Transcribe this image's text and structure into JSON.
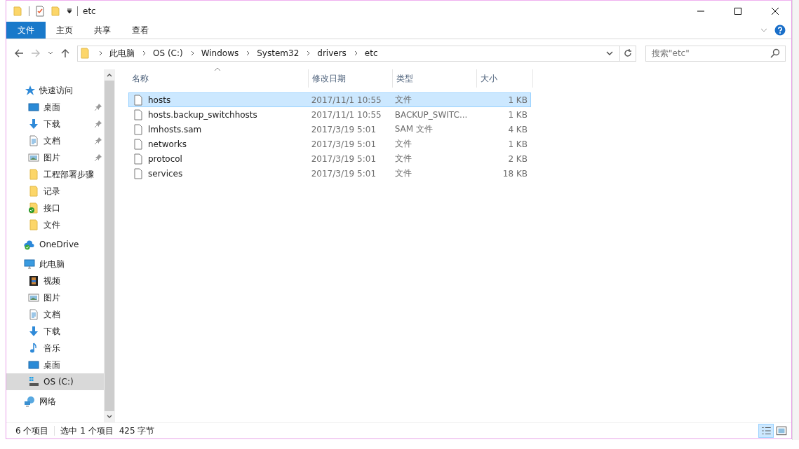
{
  "window": {
    "title": "etc"
  },
  "ribbon": {
    "tabs": [
      {
        "label": "文件",
        "selected": true
      },
      {
        "label": "主页",
        "selected": false
      },
      {
        "label": "共享",
        "selected": false
      },
      {
        "label": "查看",
        "selected": false
      }
    ]
  },
  "address": {
    "breadcrumbs": [
      "此电脑",
      "OS (C:)",
      "Windows",
      "System32",
      "drivers",
      "etc"
    ]
  },
  "search": {
    "placeholder": "搜索\"etc\""
  },
  "sidebar": {
    "sections": [
      {
        "label": "快速访问",
        "kind": "star",
        "selected": false,
        "children": [
          {
            "label": "桌面",
            "kind": "desktop",
            "pinned": true,
            "selected": false
          },
          {
            "label": "下载",
            "kind": "download",
            "pinned": true,
            "selected": false
          },
          {
            "label": "文档",
            "kind": "document",
            "pinned": true,
            "selected": false
          },
          {
            "label": "图片",
            "kind": "picture",
            "pinned": true,
            "selected": false
          },
          {
            "label": "工程部署步骤",
            "kind": "folder",
            "pinned": false,
            "selected": false
          },
          {
            "label": "记录",
            "kind": "folder",
            "pinned": false,
            "selected": false
          },
          {
            "label": "接口",
            "kind": "folder-synced",
            "pinned": false,
            "selected": false
          },
          {
            "label": "文件",
            "kind": "folder",
            "pinned": false,
            "selected": false
          }
        ]
      },
      {
        "label": "OneDrive",
        "kind": "cloud",
        "selected": false
      },
      {
        "label": "此电脑",
        "kind": "computer",
        "selected": false,
        "children": [
          {
            "label": "视频",
            "kind": "video",
            "pinned": false,
            "selected": false
          },
          {
            "label": "图片",
            "kind": "picture",
            "pinned": false,
            "selected": false
          },
          {
            "label": "文档",
            "kind": "document",
            "pinned": false,
            "selected": false
          },
          {
            "label": "下载",
            "kind": "download",
            "pinned": false,
            "selected": false
          },
          {
            "label": "音乐",
            "kind": "music",
            "pinned": false,
            "selected": false
          },
          {
            "label": "桌面",
            "kind": "desktop",
            "pinned": false,
            "selected": false
          },
          {
            "label": "OS (C:)",
            "kind": "drive",
            "pinned": false,
            "selected": true
          }
        ]
      },
      {
        "label": "网络",
        "kind": "network",
        "selected": false
      }
    ]
  },
  "table": {
    "columns": [
      "名称",
      "修改日期",
      "类型",
      "大小"
    ],
    "rows": [
      {
        "name": "hosts",
        "modified": "2017/11/1 10:55",
        "type": "文件",
        "size": "1 KB",
        "selected": true
      },
      {
        "name": "hosts.backup_switchhosts",
        "modified": "2017/11/1 10:55",
        "type": "BACKUP_SWITC...",
        "size": "1 KB",
        "selected": false
      },
      {
        "name": "lmhosts.sam",
        "modified": "2017/3/19 5:01",
        "type": "SAM 文件",
        "size": "4 KB",
        "selected": false
      },
      {
        "name": "networks",
        "modified": "2017/3/19 5:01",
        "type": "文件",
        "size": "1 KB",
        "selected": false
      },
      {
        "name": "protocol",
        "modified": "2017/3/19 5:01",
        "type": "文件",
        "size": "2 KB",
        "selected": false
      },
      {
        "name": "services",
        "modified": "2017/3/19 5:01",
        "type": "文件",
        "size": "18 KB",
        "selected": false
      }
    ]
  },
  "status_bar": {
    "item_count": "6 个项目",
    "selection": "选中 1 个项目",
    "size": "425 字节"
  }
}
